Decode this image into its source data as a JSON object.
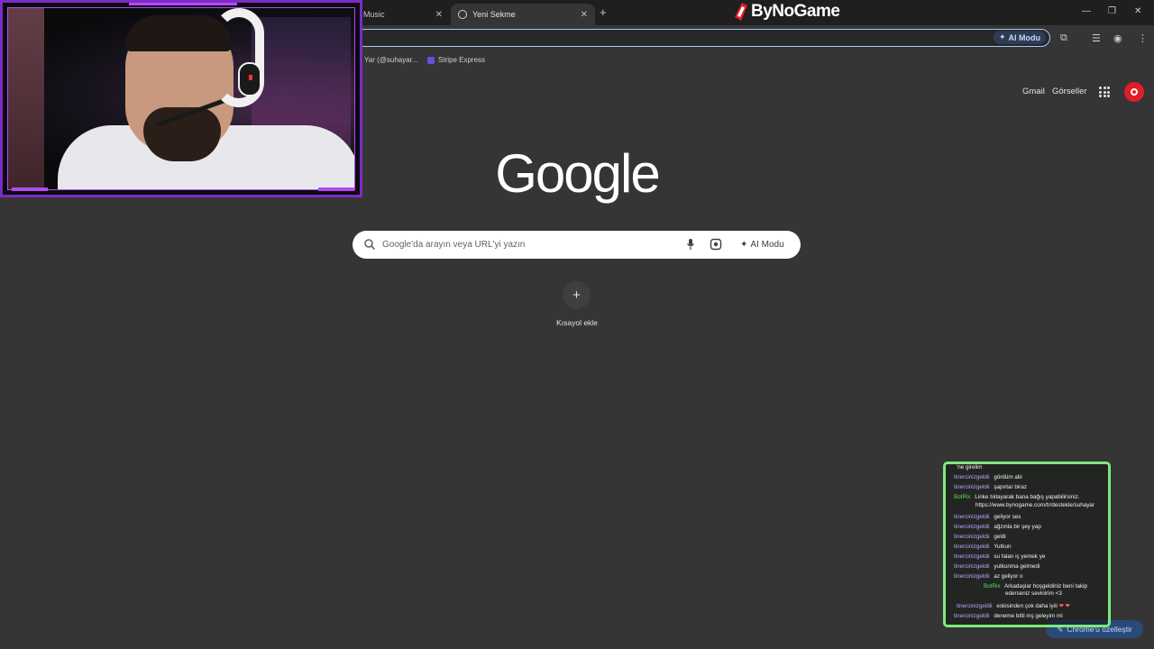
{
  "tabs": [
    {
      "label": "Music",
      "active": false
    },
    {
      "label": "Yeni Sekme",
      "active": true
    }
  ],
  "brand": {
    "name": "ByNoGame",
    "accent": "#e11d2a"
  },
  "omnibox": {
    "ai_mode_label": "AI Modu",
    "value": ""
  },
  "bookmarks": [
    {
      "label": "Yar (@suhayar...",
      "icon": "bookmark-icon"
    },
    {
      "label": "Stripe Express",
      "icon": "stripe-icon"
    }
  ],
  "google": {
    "header_links": [
      "Gmail",
      "Görseller"
    ],
    "logo": "Google",
    "search_placeholder": "Google'da arayın veya URL'yi yazın",
    "ai_mode_label": "AI Modu",
    "shortcut_add_label": "Kısayol ekle",
    "customize_label": "Chrome'u özelleştir"
  },
  "chat": {
    "messages": [
      {
        "user": "",
        "text": "'ne girelim"
      },
      {
        "user": "tinercinizgeldii",
        "text": "gördüm abi"
      },
      {
        "user": "tinercinizgeldii",
        "text": "şapırtar biraz"
      },
      {
        "user": "BotRix",
        "text": "Linke tıklayarak bana bağış yapabilirsiniz.",
        "text2": "https://www.bynogame.com/tr/destekle/suhayar"
      },
      {
        "user": "tinercinizgeldii",
        "text": "geliyor ses"
      },
      {
        "user": "tinercinizgeldii",
        "text": "ağzınla bir şey yap"
      },
      {
        "user": "tinercinizgeldii",
        "text": "geldi"
      },
      {
        "user": "tinercinizgeldii",
        "text": "Yutkun"
      },
      {
        "user": "tinercinizgeldii",
        "text": "su falan iç yemek ye"
      },
      {
        "user": "tinercinizgeldii",
        "text": "yutkunma gelmedi"
      },
      {
        "user": "tinercinizgeldii",
        "text": "az geliyor o"
      },
      {
        "user": "BotRix",
        "text": "Arkadaşlar hoşgeldiniz beni takip",
        "text2": "ederseniz sevinirim <3"
      },
      {
        "user": "tinercinizgeldii",
        "text": "eskisinden çok daha iyiii",
        "hearts": "❤ ❤"
      },
      {
        "user": "tinercinizgeldii",
        "text": "deneme bitti mş geleyim mi"
      }
    ]
  }
}
